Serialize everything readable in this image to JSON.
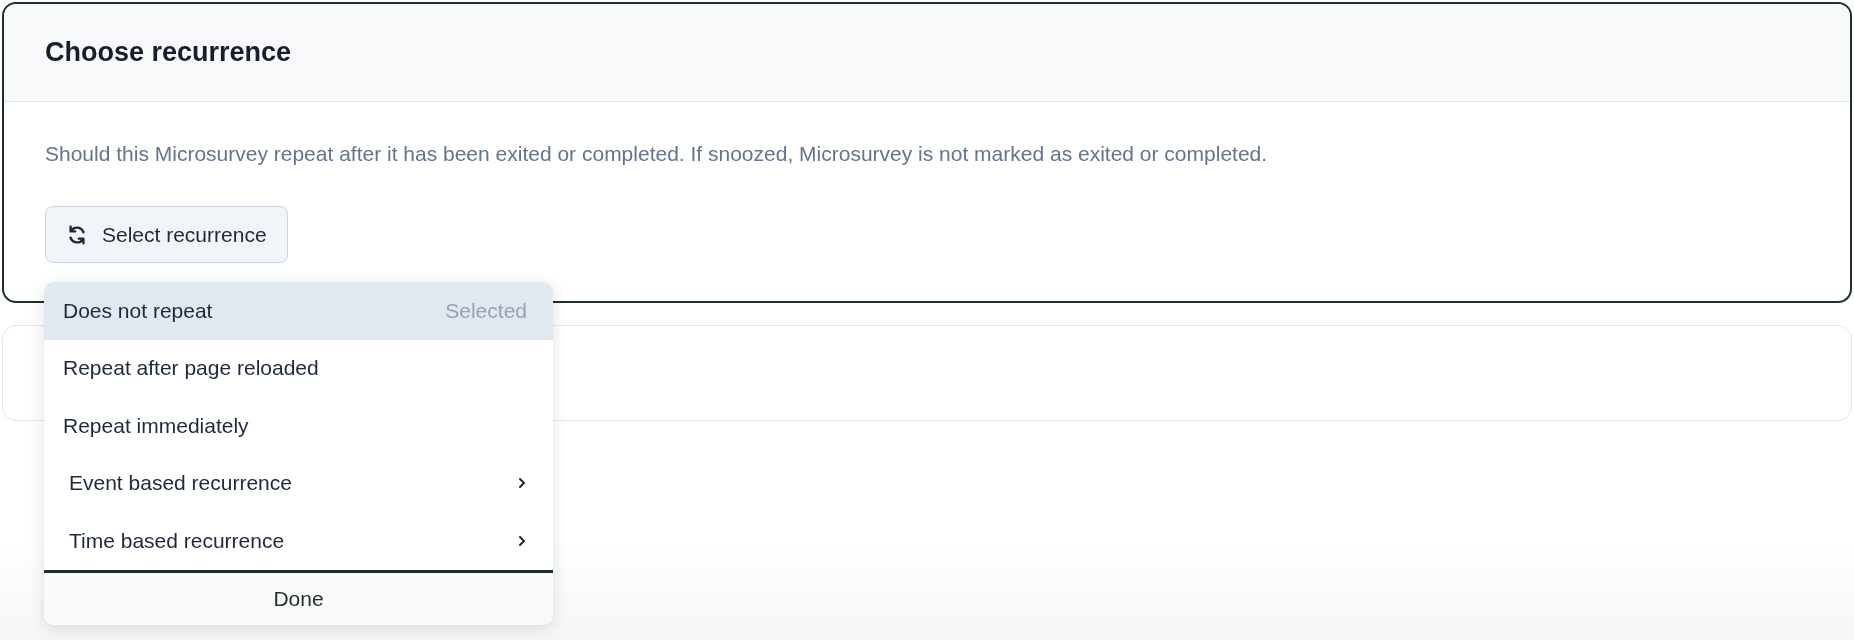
{
  "card": {
    "title": "Choose recurrence",
    "description": "Should this Microsurvey repeat after it has been exited or completed. If snoozed, Microsurvey is not marked as exited or completed.",
    "button": {
      "label": "Select recurrence"
    }
  },
  "dropdown": {
    "options": [
      {
        "label": "Does not repeat",
        "kind": "option",
        "selected": true,
        "hint": "Selected"
      },
      {
        "label": "Repeat after page reloaded",
        "kind": "option",
        "selected": false
      },
      {
        "label": "Repeat immediately",
        "kind": "option",
        "selected": false
      },
      {
        "label": "Event based recurrence",
        "kind": "submenu",
        "selected": false
      },
      {
        "label": "Time based recurrence",
        "kind": "submenu",
        "selected": false
      }
    ],
    "done": "Done"
  }
}
